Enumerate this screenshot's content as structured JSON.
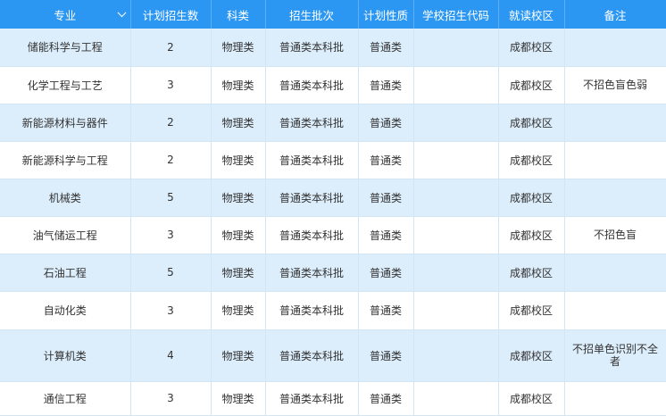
{
  "header": {
    "major": "专业",
    "plan_count": "计划招生数",
    "subject": "科类",
    "batch": "招生批次",
    "nature": "计划性质",
    "code": "学校招生代码",
    "campus": "就读校区",
    "note": "备注"
  },
  "rows": [
    {
      "major": "储能科学与工程",
      "plan_count": "2",
      "subject": "物理类",
      "batch": "普通类本科批",
      "nature": "普通类",
      "code": "",
      "campus": "成都校区",
      "note": ""
    },
    {
      "major": "化学工程与工艺",
      "plan_count": "3",
      "subject": "物理类",
      "batch": "普通类本科批",
      "nature": "普通类",
      "code": "",
      "campus": "成都校区",
      "note": "不招色盲色弱"
    },
    {
      "major": "新能源材料与器件",
      "plan_count": "2",
      "subject": "物理类",
      "batch": "普通类本科批",
      "nature": "普通类",
      "code": "",
      "campus": "成都校区",
      "note": ""
    },
    {
      "major": "新能源科学与工程",
      "plan_count": "2",
      "subject": "物理类",
      "batch": "普通类本科批",
      "nature": "普通类",
      "code": "",
      "campus": "成都校区",
      "note": ""
    },
    {
      "major": "机械类",
      "plan_count": "5",
      "subject": "物理类",
      "batch": "普通类本科批",
      "nature": "普通类",
      "code": "",
      "campus": "成都校区",
      "note": ""
    },
    {
      "major": "油气储运工程",
      "plan_count": "3",
      "subject": "物理类",
      "batch": "普通类本科批",
      "nature": "普通类",
      "code": "",
      "campus": "成都校区",
      "note": "不招色盲"
    },
    {
      "major": "石油工程",
      "plan_count": "5",
      "subject": "物理类",
      "batch": "普通类本科批",
      "nature": "普通类",
      "code": "",
      "campus": "成都校区",
      "note": ""
    },
    {
      "major": "自动化类",
      "plan_count": "3",
      "subject": "物理类",
      "batch": "普通类本科批",
      "nature": "普通类",
      "code": "",
      "campus": "成都校区",
      "note": ""
    },
    {
      "major": "计算机类",
      "plan_count": "4",
      "subject": "物理类",
      "batch": "普通类本科批",
      "nature": "普通类",
      "code": "",
      "campus": "成都校区",
      "note": "不招单色识别不全者"
    },
    {
      "major": "通信工程",
      "plan_count": "3",
      "subject": "物理类",
      "batch": "普通类本科批",
      "nature": "普通类",
      "code": "",
      "campus": "成都校区",
      "note": ""
    }
  ],
  "colors": {
    "header_bg": "#2b97f3",
    "row_alt_bg": "#dcedfb",
    "row_bg": "#ffffff",
    "text": "#333333"
  },
  "icons": {
    "major_sort": "chevron-down-icon"
  }
}
